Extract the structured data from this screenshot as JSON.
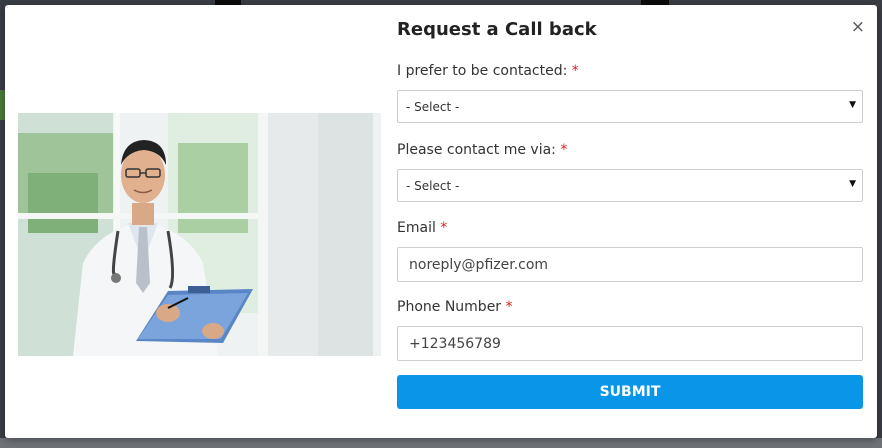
{
  "modal": {
    "title": "Request a Call back",
    "close_glyph": "×",
    "required_mark": "*",
    "fields": {
      "preferred_time": {
        "label": "I prefer to be contacted:",
        "value": "- Select -"
      },
      "contact_method": {
        "label": "Please contact me via:",
        "value": "- Select -"
      },
      "email": {
        "label": "Email",
        "value": "noreply@pfizer.com"
      },
      "phone": {
        "label": "Phone Number",
        "value": "+123456789"
      }
    },
    "submit_label": "SUBMIT"
  },
  "colors": {
    "accent": "#0a96e8",
    "required": "#e02020"
  },
  "icons": {
    "close": "close-icon",
    "dropdown": "chevron-down-icon"
  }
}
